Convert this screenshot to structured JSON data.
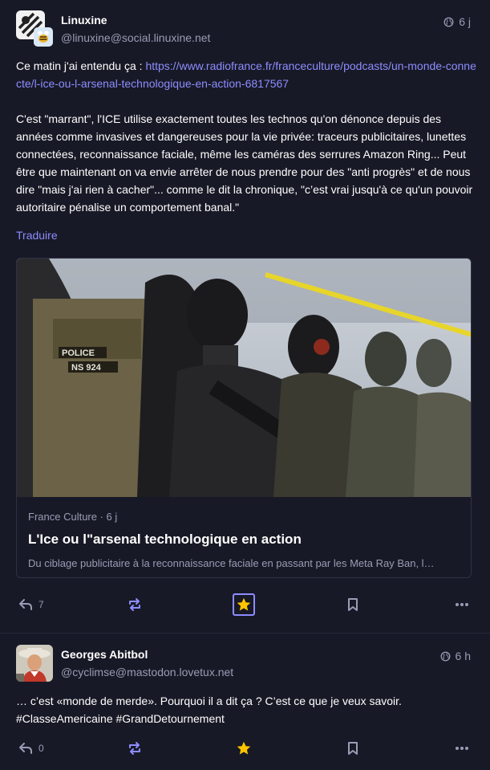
{
  "colors": {
    "background": "#181926",
    "link": "#8c8dff",
    "boost": "#8c8dff",
    "favourite": "#ffc400",
    "muted": "#9a9cb5"
  },
  "posts": [
    {
      "author_name": "Linuxine",
      "author_handle": "@linuxine@social.linuxine.net",
      "visibility_icon": "globe-icon",
      "time": "6 j",
      "intro_text": "Ce matin j'ai entendu ça : ",
      "intro_link": "https://www.radiofrance.fr/franceculture/podcasts/un-monde-connecte/l-ice-ou-l-arsenal-technologique-en-action-6817567",
      "body": "C'est \"marrant\", l'ICE utilise exactement toutes les technos qu'on dénonce depuis des années comme invasives et dangereuses pour la vie privée: traceurs publicitaires, lunettes connectées, reconnaissance faciale, même les caméras des serrures Amazon Ring... Peut être que maintenant on va envie arrêter de nous prendre pour des \"anti progrès\" et de nous dire \"mais j'ai rien à cacher\"... comme le dit la chronique, \"c’est vrai jusqu'à ce qu'un pouvoir autoritaire pénalise un comportement banal.\"",
      "translate_label": "Traduire",
      "card": {
        "source": "France Culture · 6 j",
        "title": "L'Ice ou l\"arsenal technologique en action",
        "description": "Du ciblage publicitaire à la reconnaissance faciale en passant par les Meta Ray Ban, l…",
        "image_icon": "riot-police-photo",
        "image_text": "POLICE\nNS 924"
      },
      "actions": {
        "reply_count": "7",
        "favourited": true
      }
    },
    {
      "author_name": "Georges Abitbol",
      "author_handle": "@cyclimse@mastodon.lovetux.net",
      "visibility_icon": "globe-icon",
      "time": "6 h",
      "body": "… c’est «monde de merde». Pourquoi il a dit ça ? C’est ce que je veux savoir. #ClasseAmericaine #GrandDetournement",
      "actions": {
        "reply_count": "0",
        "favourited": true
      }
    }
  ]
}
